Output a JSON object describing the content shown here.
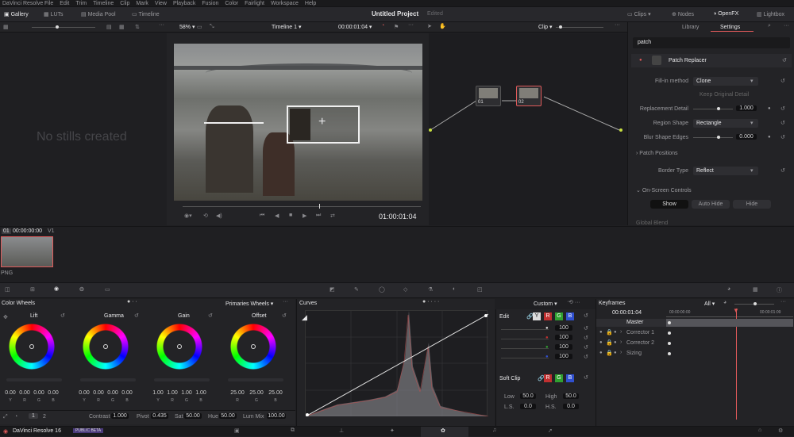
{
  "menu": {
    "app": "DaVinci Resolve",
    "items": [
      "File",
      "Edit",
      "Trim",
      "Timeline",
      "Clip",
      "Mark",
      "View",
      "Playback",
      "Fusion",
      "Color",
      "Fairlight",
      "Workspace",
      "Help"
    ]
  },
  "toolbar": {
    "gallery": "Gallery",
    "luts": "LUTs",
    "media_pool": "Media Pool",
    "timeline": "Timeline",
    "project_title": "Untitled Project",
    "edited": "Edited",
    "clips": "Clips",
    "nodes": "Nodes",
    "openfx": "OpenFX",
    "lightbox": "Lightbox"
  },
  "viewer": {
    "zoom": "58%",
    "timeline_name": "Timeline 1",
    "timecode": "00:00:01:04",
    "timecode_display": "01:00:01:04"
  },
  "gallery": {
    "empty_text": "No stills created"
  },
  "nodes": {
    "mode": "Clip",
    "node1": "01",
    "node2": "02"
  },
  "fx": {
    "tab_library": "Library",
    "tab_settings": "Settings",
    "search_value": "patch",
    "plugin_name": "Patch Replacer",
    "fill_method_label": "Fill-in method",
    "fill_method_value": "Clone",
    "keep_original_detail": "Keep Original Detail",
    "replacement_detail_label": "Replacement Detail",
    "replacement_detail_value": "1.000",
    "region_shape_label": "Region Shape",
    "region_shape_value": "Rectangle",
    "blur_shape_edges_label": "Blur Shape Edges",
    "blur_shape_edges_value": "0.000",
    "patch_positions": "Patch Positions",
    "border_type_label": "Border Type",
    "border_type_value": "Reflect",
    "onscreen_controls": "On-Screen Controls",
    "show": "Show",
    "auto_hide": "Auto Hide",
    "hide": "Hide",
    "global_blend": "Global Blend"
  },
  "clips": {
    "index": "01",
    "timecode": "00:00:00:00",
    "track": "V1",
    "format": "PNG"
  },
  "color_wheels": {
    "title": "Color Wheels",
    "mode": "Primaries Wheels",
    "wheels": [
      {
        "name": "Lift",
        "values": [
          "0.00",
          "0.00",
          "0.00",
          "0.00"
        ]
      },
      {
        "name": "Gamma",
        "values": [
          "0.00",
          "0.00",
          "0.00",
          "0.00"
        ]
      },
      {
        "name": "Gain",
        "values": [
          "1.00",
          "1.00",
          "1.00",
          "1.00"
        ]
      },
      {
        "name": "Offset",
        "values": [
          "25.00",
          "25.00",
          "25.00"
        ]
      }
    ],
    "ybrg": [
      "Y",
      "R",
      "G",
      "B"
    ],
    "rgb": [
      "R",
      "G",
      "B"
    ],
    "page1": "1",
    "page2": "2",
    "contrast_label": "Contrast",
    "contrast_value": "1.000",
    "pivot_label": "Pivot",
    "pivot_value": "0.435",
    "sat_label": "Sat",
    "sat_value": "50.00",
    "hue_label": "Hue",
    "hue_value": "50.00",
    "lummix_label": "Lum Mix",
    "lummix_value": "100.00"
  },
  "curves": {
    "title": "Curves",
    "mode": "Custom",
    "edit_label": "Edit",
    "y_label": "Y",
    "r_label": "R",
    "g_label": "G",
    "b_label": "B",
    "edit_values": [
      "100",
      "100",
      "100",
      "100"
    ],
    "soft_clip_label": "Soft Clip",
    "low_label": "Low",
    "low_value": "50.0",
    "high_label": "High",
    "high_value": "50.0",
    "ls_label": "L.S.",
    "ls_value": "0.0",
    "hs_label": "H.S.",
    "hs_value": "0.0"
  },
  "keyframes": {
    "title": "Keyframes",
    "filter": "All",
    "timecode": "00:00:01:04",
    "start_tc": "00:00:00:00",
    "end_tc": "00:00:01:09",
    "master": "Master",
    "rows": [
      "Corrector 1",
      "Corrector 2",
      "Sizing"
    ]
  },
  "status": {
    "app_version": "DaVinci Resolve 16",
    "beta": "PUBLIC BETA"
  },
  "colors": {
    "accent_red": "#e05a5a",
    "bg": "#1f1f22",
    "panel": "#28282c"
  }
}
